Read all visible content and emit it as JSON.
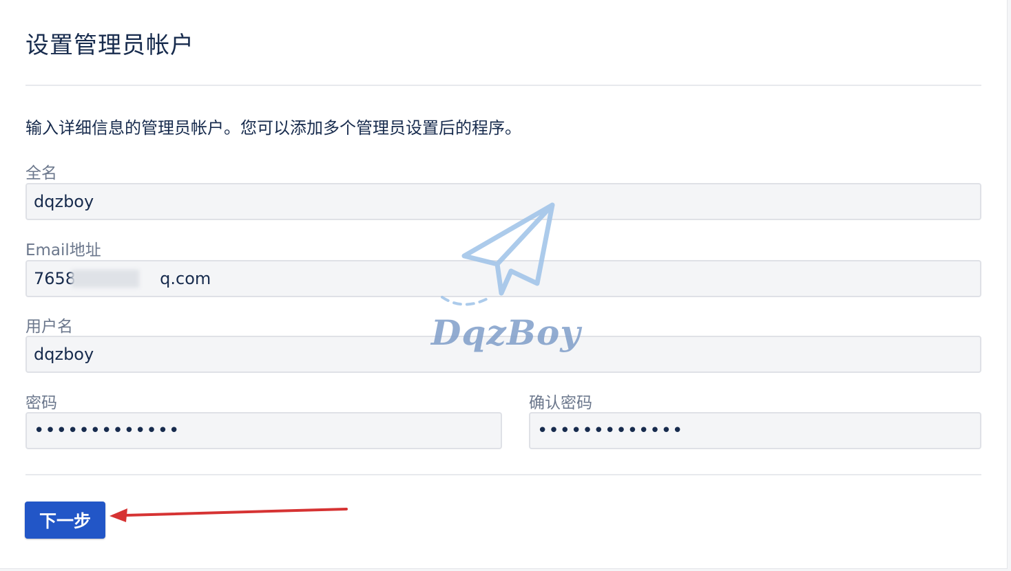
{
  "page": {
    "title": "设置管理员帐户",
    "description": "输入详细信息的管理员帐户。您可以添加多个管理员设置后的程序。"
  },
  "form": {
    "full_name": {
      "label": "全名",
      "value": "dqzboy"
    },
    "email": {
      "label": "Email地址",
      "value": "7658                q.com"
    },
    "username": {
      "label": "用户名",
      "value": "dqzboy"
    },
    "password": {
      "label": "密码",
      "value": "•••••••••••••"
    },
    "confirm_password": {
      "label": "确认密码",
      "value": "•••••••••••••"
    }
  },
  "actions": {
    "next_label": "下一步"
  },
  "annotation": {
    "arrow_color": "#d63333"
  },
  "watermark": {
    "text": "DqzBoy",
    "icon": "paper-plane-icon",
    "color": "#7f9ec9"
  },
  "colors": {
    "primary_button": "#2256c7",
    "input_background": "#f4f5f7",
    "input_border": "#dfe1e6"
  }
}
